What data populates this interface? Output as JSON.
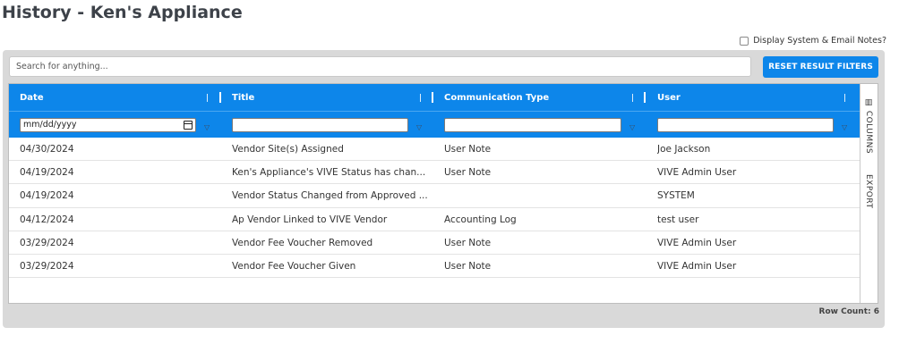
{
  "page": {
    "title": "History - Ken's Appliance"
  },
  "options": {
    "system_notes_label": "Display System & Email Notes?"
  },
  "toolbar": {
    "search_placeholder": "Search for anything...",
    "reset_label": "RESET RESULT FILTERS"
  },
  "grid": {
    "columns": [
      "Date",
      "Title",
      "Communication Type",
      "User"
    ],
    "date_filter_placeholder": "mm/dd/yyyy",
    "rows": [
      [
        "04/30/2024",
        "Vendor Site(s) Assigned",
        "User Note",
        "Joe Jackson"
      ],
      [
        "04/19/2024",
        "Ken's Appliance's VIVE Status has chan...",
        "User Note",
        "VIVE Admin User"
      ],
      [
        "04/19/2024",
        "Vendor Status Changed from Approved ...",
        "",
        "SYSTEM"
      ],
      [
        "04/12/2024",
        "Ap Vendor Linked to VIVE Vendor",
        "Accounting Log",
        "test user"
      ],
      [
        "03/29/2024",
        "Vendor Fee Voucher Removed",
        "User Note",
        "VIVE Admin User"
      ],
      [
        "03/29/2024",
        "Vendor Fee Voucher Given",
        "User Note",
        "VIVE Admin User"
      ]
    ],
    "side_tabs": {
      "columns": "COLUMNS",
      "export": "EXPORT"
    },
    "row_count": "Row Count: 6"
  },
  "colors": {
    "accent": "#0d86ea",
    "panel": "#d9d9d9"
  }
}
